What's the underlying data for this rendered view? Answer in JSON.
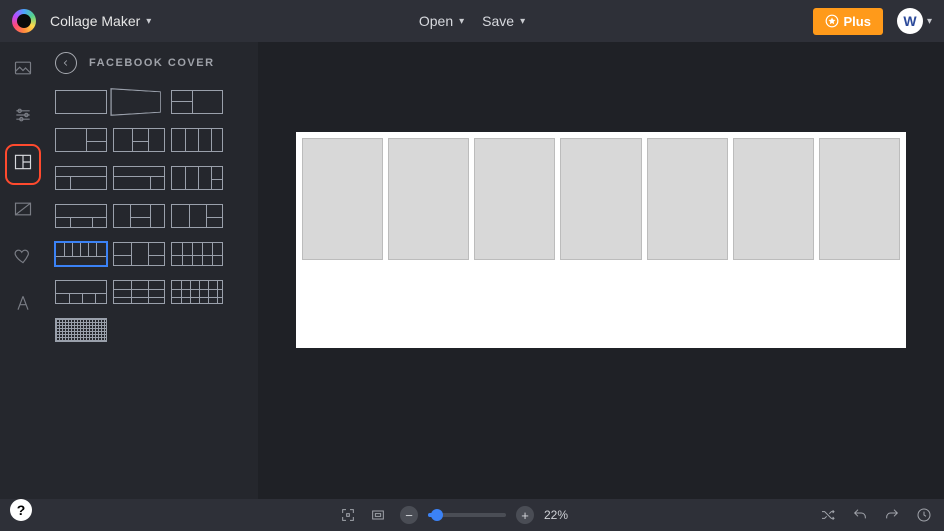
{
  "header": {
    "app_name": "Collage Maker",
    "open_label": "Open",
    "save_label": "Save",
    "plus_label": "Plus",
    "avatar_letter": "W"
  },
  "rail": {
    "active_index": 2,
    "items": [
      "image-icon",
      "sliders-icon",
      "layout-icon",
      "crop-icon",
      "heart-icon",
      "text-icon"
    ]
  },
  "sidebar": {
    "title": "FACEBOOK COVER",
    "back_icon": "arrow-left-icon",
    "selected_index": 15,
    "templates_count": 21
  },
  "canvas": {
    "columns": 7
  },
  "bottombar": {
    "zoom_percent": "22%",
    "zoom_value": 22,
    "zoom_min": 0,
    "zoom_max": 200
  },
  "help": {
    "label": "?"
  }
}
